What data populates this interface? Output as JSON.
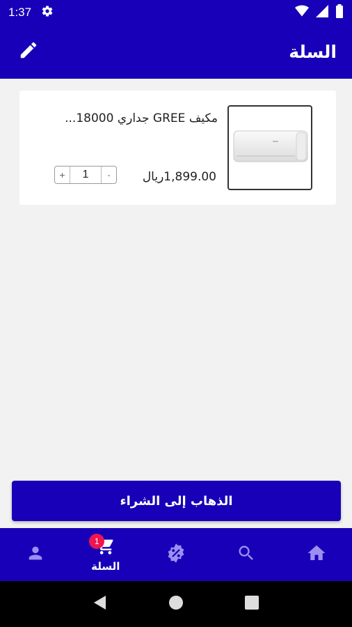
{
  "status_bar": {
    "time": "1:37",
    "icons": [
      "gear-icon",
      "wifi-icon",
      "signal-icon",
      "battery-icon"
    ]
  },
  "app_bar": {
    "title": "السلة",
    "edit_icon": "pencil-icon"
  },
  "cart": {
    "items": [
      {
        "name": "مكيف GREE جداري 18000...",
        "price": "1,899.00ريال",
        "quantity": "1",
        "minus_label": "-",
        "plus_label": "+",
        "image_icon": "air-conditioner-image"
      }
    ]
  },
  "checkout": {
    "label": "الذهاب إلى الشراء"
  },
  "bottom_nav": {
    "items": [
      {
        "icon": "person-icon",
        "label": ""
      },
      {
        "icon": "cart-icon",
        "label": "السلة",
        "badge": "1"
      },
      {
        "icon": "discount-icon",
        "label": ""
      },
      {
        "icon": "search-icon",
        "label": ""
      },
      {
        "icon": "home-icon",
        "label": ""
      }
    ],
    "active_color": "#ffffff",
    "inactive_color": "#9c8ff0"
  },
  "colors": {
    "primary": "#1800b8",
    "background": "#f2f2f2",
    "badge": "#ee1650"
  }
}
